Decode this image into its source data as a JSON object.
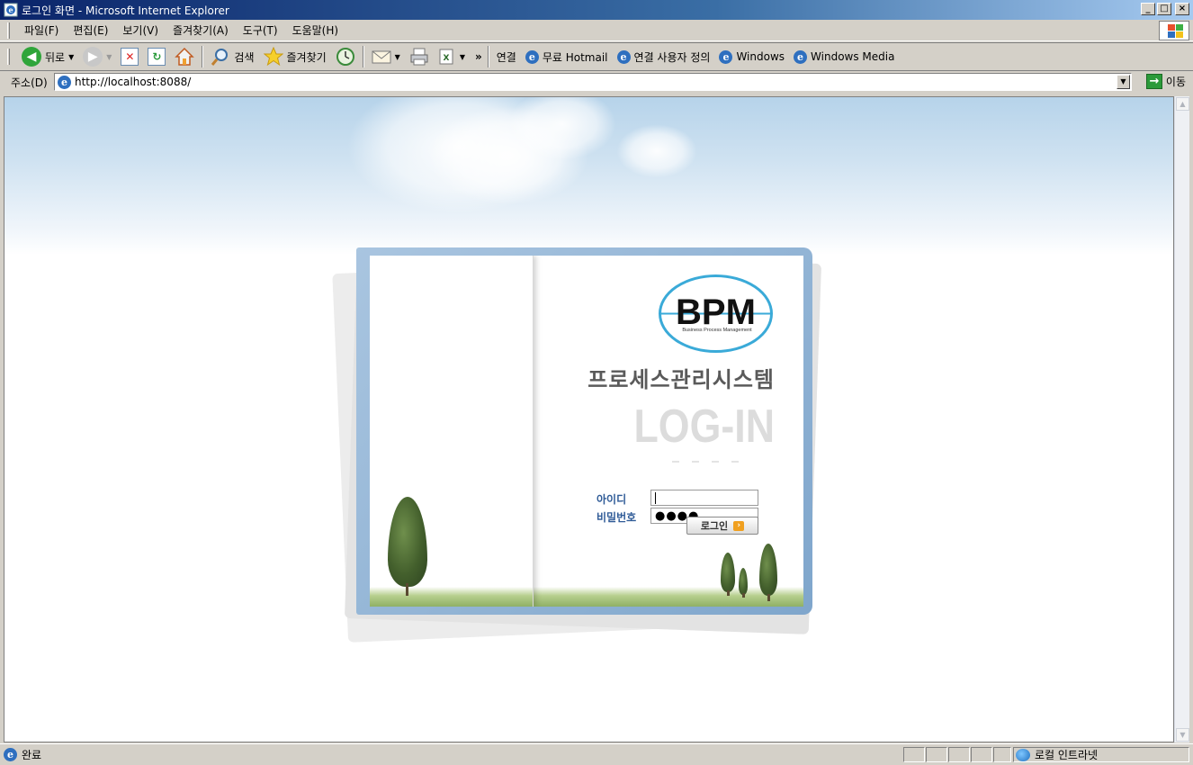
{
  "window": {
    "title": "로그인 화면 - Microsoft Internet Explorer",
    "controls": {
      "minimize": "_",
      "maximize": "□",
      "close": "×"
    }
  },
  "menu": {
    "items": [
      "파일(F)",
      "편집(E)",
      "보기(V)",
      "즐겨찾기(A)",
      "도구(T)",
      "도움말(H)"
    ]
  },
  "toolbar": {
    "back_label": "뒤로",
    "search_label": "검색",
    "favorites_label": "즐겨찾기",
    "chevron": "»",
    "links_label": "연결",
    "links": [
      "무료 Hotmail",
      "연결 사용자 정의",
      "Windows",
      "Windows Media"
    ]
  },
  "address": {
    "label": "주소(D)",
    "url": "http://localhost:8088/",
    "go_label": "이동"
  },
  "login": {
    "logo_text": "BPM",
    "logo_subtext": "Business Process Management",
    "brand_title": "프로세스관리시스템",
    "heading": "LOG-IN",
    "id_label": "아이디",
    "id_value": "",
    "password_label": "비밀번호",
    "password_value": "●●●●",
    "login_button": "로그인"
  },
  "status": {
    "text": "완료",
    "zone": "로컬 인트라넷"
  },
  "colors": {
    "titlebar_start": "#0a246a",
    "chrome": "#d4d0c8",
    "frame_blue": "#7fa6cc",
    "label_blue": "#2f5b97",
    "logo_ring": "#3aaad8"
  },
  "icons": [
    "ie-icon",
    "back-icon",
    "forward-icon",
    "stop-icon",
    "refresh-icon",
    "home-icon",
    "search-icon",
    "star-icon",
    "history-icon",
    "mail-icon",
    "print-icon",
    "edit-icon",
    "go-icon",
    "globe-icon",
    "windows-flag-icon"
  ]
}
